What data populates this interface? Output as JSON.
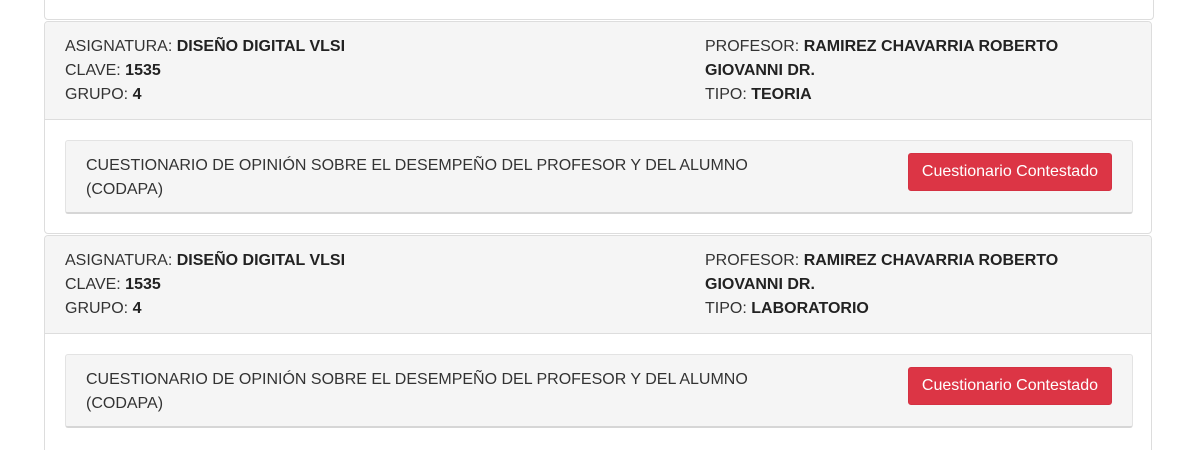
{
  "labels": {
    "asignatura": "ASIGNATURA: ",
    "clave": "CLAVE: ",
    "grupo": "GRUPO: ",
    "profesor": "PROFESOR: ",
    "tipo": "TIPO: "
  },
  "courses": [
    {
      "asignatura": "DISEÑO DIGITAL VLSI",
      "clave": "1535",
      "grupo": "4",
      "profesor_line1": "RAMIREZ CHAVARRIA ROBERTO",
      "profesor_line2": "GIOVANNI DR.",
      "tipo": "TEORIA",
      "survey_text_line1": "CUESTIONARIO DE OPINIÓN SOBRE EL DESEMPEÑO DEL PROFESOR Y DEL ALUMNO",
      "survey_text_line2": "(CODAPA)",
      "survey_button": "Cuestionario Contestado"
    },
    {
      "asignatura": "DISEÑO DIGITAL VLSI",
      "clave": "1535",
      "grupo": "4",
      "profesor_line1": "RAMIREZ CHAVARRIA ROBERTO",
      "profesor_line2": "GIOVANNI DR.",
      "tipo": "LABORATORIO",
      "survey_text_line1": "CUESTIONARIO DE OPINIÓN SOBRE EL DESEMPEÑO DEL PROFESOR Y DEL ALUMNO",
      "survey_text_line2": "(CODAPA)",
      "survey_button": "Cuestionario Contestado"
    }
  ],
  "colors": {
    "button_bg": "#dc3545",
    "header_bg": "#f5f5f5"
  }
}
